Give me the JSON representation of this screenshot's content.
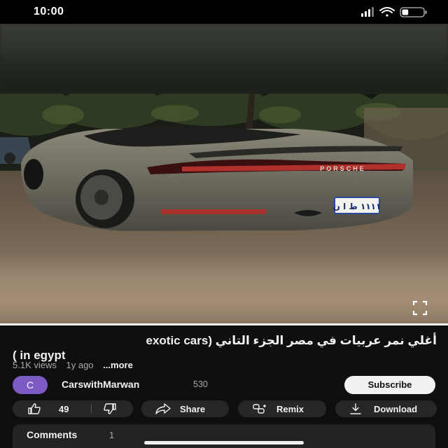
{
  "status_bar": {
    "time": "10:00",
    "battery_level": 0.3
  },
  "video": {
    "progress": 1.0,
    "plate_text": "١١١١ ط ا ن",
    "brand_text": "PORSCHE",
    "fullscreen_icon": "fullscreen-icon"
  },
  "title": {
    "line1": "أغلي نمر عربيات في مصر الجزء التاني (exotic cars",
    "line2": "( in egypt"
  },
  "meta": {
    "views": "5.1K views",
    "age": "1y ago",
    "more": "...more"
  },
  "channel": {
    "avatar_letter": "C",
    "name": "CarswithMarwan",
    "subscribers": "530",
    "subscribe_label": "Subscribe"
  },
  "actions": {
    "likes": "49",
    "share": "Share",
    "remix": "Remix",
    "download": "Download"
  },
  "comments": {
    "label": "Comments",
    "count": "1"
  },
  "colors": {
    "background": "#0f0f0f",
    "pill": "#272727",
    "avatar": "#7c5cc4",
    "subscribe": "#f1f1f1"
  }
}
